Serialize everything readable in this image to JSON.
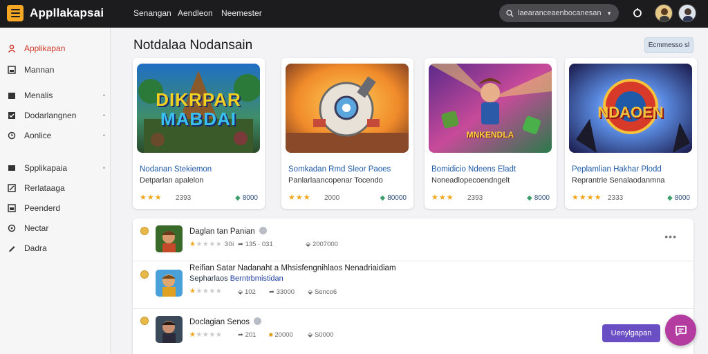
{
  "app": {
    "title": "Appllakapsai"
  },
  "topnav": [
    "Senangan",
    "Aendleon",
    "Neemester"
  ],
  "search": {
    "placeholder": "laearanceaenbocanesan"
  },
  "sidebar": {
    "items": [
      {
        "label": "Applikapan",
        "icon": "user-icon",
        "active": true,
        "arrow": false
      },
      {
        "label": "Mannan",
        "icon": "image-icon",
        "active": false,
        "arrow": false
      },
      {
        "label": "Menalis",
        "icon": "folder-icon",
        "active": false,
        "arrow": true
      },
      {
        "label": "Dodarlangnen",
        "icon": "checkbox-icon",
        "active": false,
        "arrow": true
      },
      {
        "label": "Aonlice",
        "icon": "clock-icon",
        "active": false,
        "arrow": true
      },
      {
        "label": "Spplikapaia",
        "icon": "grid-icon",
        "active": false,
        "arrow": true
      },
      {
        "label": "Rerlataaga",
        "icon": "edit-icon",
        "active": false,
        "arrow": false
      },
      {
        "label": "Peenderd",
        "icon": "calendar-icon",
        "active": false,
        "arrow": false
      },
      {
        "label": "Nectar",
        "icon": "circle-icon",
        "active": false,
        "arrow": false
      },
      {
        "label": "Dadra",
        "icon": "pen-icon",
        "active": false,
        "arrow": false
      }
    ]
  },
  "main": {
    "title": "Notdalaa Nodansain",
    "top_button": "Ecmmesso sl"
  },
  "cards": [
    {
      "art_text_1": "DIKRPAR",
      "art_text_2": "MABDAI",
      "title": "Nodanan Stekiemon",
      "subtitle": "Detparlan apalelon",
      "stars": "★★★",
      "rating": "2393",
      "price": "8000"
    },
    {
      "art_text_1": "",
      "art_text_2": "",
      "title": "Somkadan Rmd Sleor Paoes",
      "subtitle": "Panlarlaancopenar Tocendo",
      "stars": "★★★",
      "rating": "2000",
      "price": "80000"
    },
    {
      "art_text_1": "MNKENDLA",
      "art_text_2": "",
      "title": "Bomidicio Ndeens Eladt",
      "subtitle": "Noneadlopecoendngelt",
      "stars": "★★★",
      "rating": "2393",
      "price": "8000"
    },
    {
      "art_text_1": "NDAOEN",
      "art_text_2": "",
      "title": "Peplamlian Hakhar Plodd",
      "subtitle": "Reprantrie Senalaodanmna",
      "stars": "★★★★",
      "rating": "2333",
      "price": "8000"
    }
  ],
  "list": [
    {
      "title": "Daglan tan Panian",
      "line2": "",
      "line2_link": "",
      "stars_filled": 1,
      "stars_empty": 4,
      "stars_text": "30i",
      "meta1": "135 · 031",
      "meta2": "2007000",
      "has_menu": true
    },
    {
      "title": "Reifian Satar Nadanaht a Mhsisfengnihlaos Nenadriaidiam",
      "line2": "Sepharlaos",
      "line2_link": "Berntrbmistidan",
      "stars_filled": 1,
      "stars_empty": 4,
      "stars_text": "",
      "meta1": "102",
      "meta2": "33000",
      "meta3": "Senco6",
      "has_menu": false
    },
    {
      "title": "Doclagian Senos",
      "line2": "",
      "line2_link": "",
      "stars_filled": 1,
      "stars_empty": 4,
      "stars_text": "",
      "meta1": "201",
      "meta2": "20000",
      "meta3": "S0000",
      "has_menu": false
    }
  ],
  "action_button": "Uenylgapan",
  "colors": {
    "topbar": "#1c1c1f",
    "accent": "#d0392b",
    "logo": "#f5a623",
    "button": "#6a4fc4",
    "fab": "#b43ca0"
  }
}
